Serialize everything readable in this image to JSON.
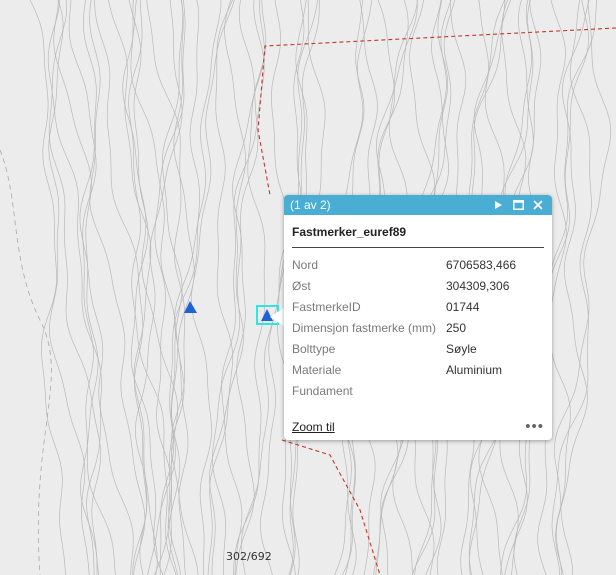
{
  "map": {
    "bottom_label": "302/692",
    "colors": {
      "background": "#ececec",
      "contour": "#b9b9b9",
      "boundary": "#c0392b",
      "marker": "#1f63d9",
      "selection": "#2ee6e6"
    },
    "markers": [
      {
        "name": "triangle-marker",
        "selected": false
      },
      {
        "name": "triangle-marker-selected",
        "selected": true
      }
    ]
  },
  "popup": {
    "count": "(1 av 2)",
    "title": "Fastmerker_euref89",
    "header_color": "#4aadd3",
    "fields": [
      {
        "key": "Nord",
        "value": "6706583,466"
      },
      {
        "key": "Øst",
        "value": "304309,306"
      },
      {
        "key": "FastmerkeID",
        "value": "01744"
      },
      {
        "key": "Dimensjon fastmerke (mm)",
        "value": "250"
      },
      {
        "key": "Bolttype",
        "value": "Søyle"
      },
      {
        "key": "Materiale",
        "value": "Aluminium"
      },
      {
        "key": "Fundament",
        "value": ""
      }
    ],
    "zoom_label": "Zoom til",
    "more_label": "•••",
    "icons": [
      "next-icon",
      "maximize-icon",
      "close-icon",
      "more-icon"
    ]
  }
}
